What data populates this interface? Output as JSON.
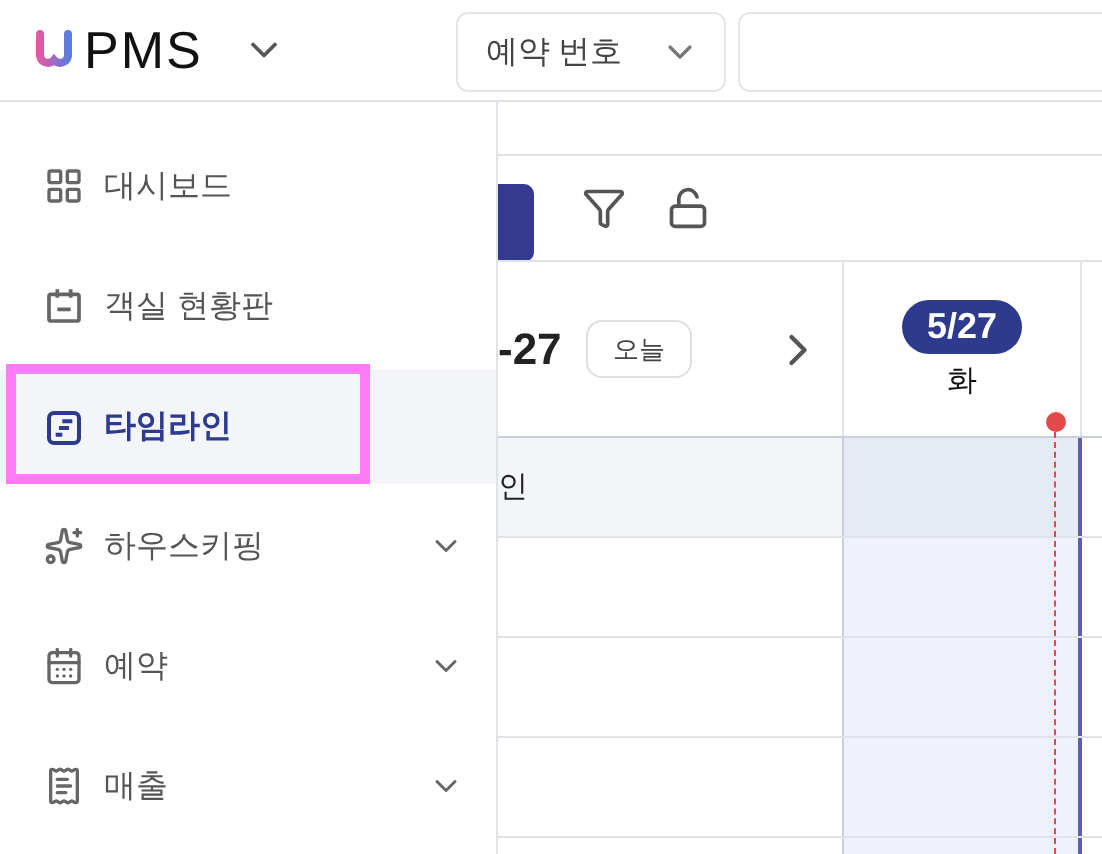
{
  "header": {
    "brand": "PMS",
    "search_type": {
      "value": "예약 번호"
    }
  },
  "sidebar": {
    "items": [
      {
        "label": "대시보드",
        "selected": false,
        "expandable": false,
        "highlighted": false
      },
      {
        "label": "객실 현황판",
        "selected": false,
        "expandable": false,
        "highlighted": false
      },
      {
        "label": "타임라인",
        "selected": true,
        "expandable": false,
        "highlighted": true
      },
      {
        "label": "하우스키핑",
        "selected": false,
        "expandable": true,
        "highlighted": false
      },
      {
        "label": "예약",
        "selected": false,
        "expandable": true,
        "highlighted": false
      },
      {
        "label": "매출",
        "selected": false,
        "expandable": true,
        "highlighted": false
      }
    ]
  },
  "timeline": {
    "range_end": "-27",
    "today_button": "오늘",
    "days": [
      {
        "date": "5/27",
        "weekday": "화",
        "today": true
      }
    ],
    "group_row": {
      "label": "인"
    }
  }
}
